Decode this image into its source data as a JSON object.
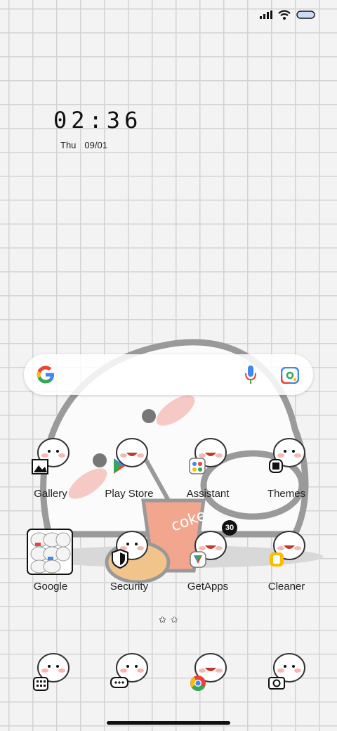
{
  "status_bar": {
    "signal": "signal-icon",
    "wifi": "wifi-icon",
    "battery": "battery-icon"
  },
  "clock": {
    "time": "02:36",
    "day": "Thu",
    "date": "09/01"
  },
  "search": {
    "logo": "google-logo-icon",
    "mic": "mic-icon",
    "lens": "lens-icon"
  },
  "apps_row1": [
    {
      "label": "Gallery",
      "icon": "gallery-icon"
    },
    {
      "label": "Play Store",
      "icon": "play-store-icon"
    },
    {
      "label": "Assistant",
      "icon": "assistant-icon"
    },
    {
      "label": "Themes",
      "icon": "themes-icon"
    }
  ],
  "apps_row2": [
    {
      "label": "Google",
      "icon": "google-folder-icon"
    },
    {
      "label": "Security",
      "icon": "security-icon"
    },
    {
      "label": "GetApps",
      "icon": "getapps-icon",
      "badge": "30"
    },
    {
      "label": "Cleaner",
      "icon": "cleaner-icon"
    }
  ],
  "dock": [
    {
      "icon": "phone-icon"
    },
    {
      "icon": "messages-icon"
    },
    {
      "icon": "chrome-icon"
    },
    {
      "icon": "camera-icon"
    }
  ],
  "wallpaper": {
    "text": "coke"
  },
  "colors": {
    "accent_blue": "#4285F4",
    "accent_red": "#EA4335",
    "accent_yellow": "#FBBC05",
    "accent_green": "#34A853"
  }
}
